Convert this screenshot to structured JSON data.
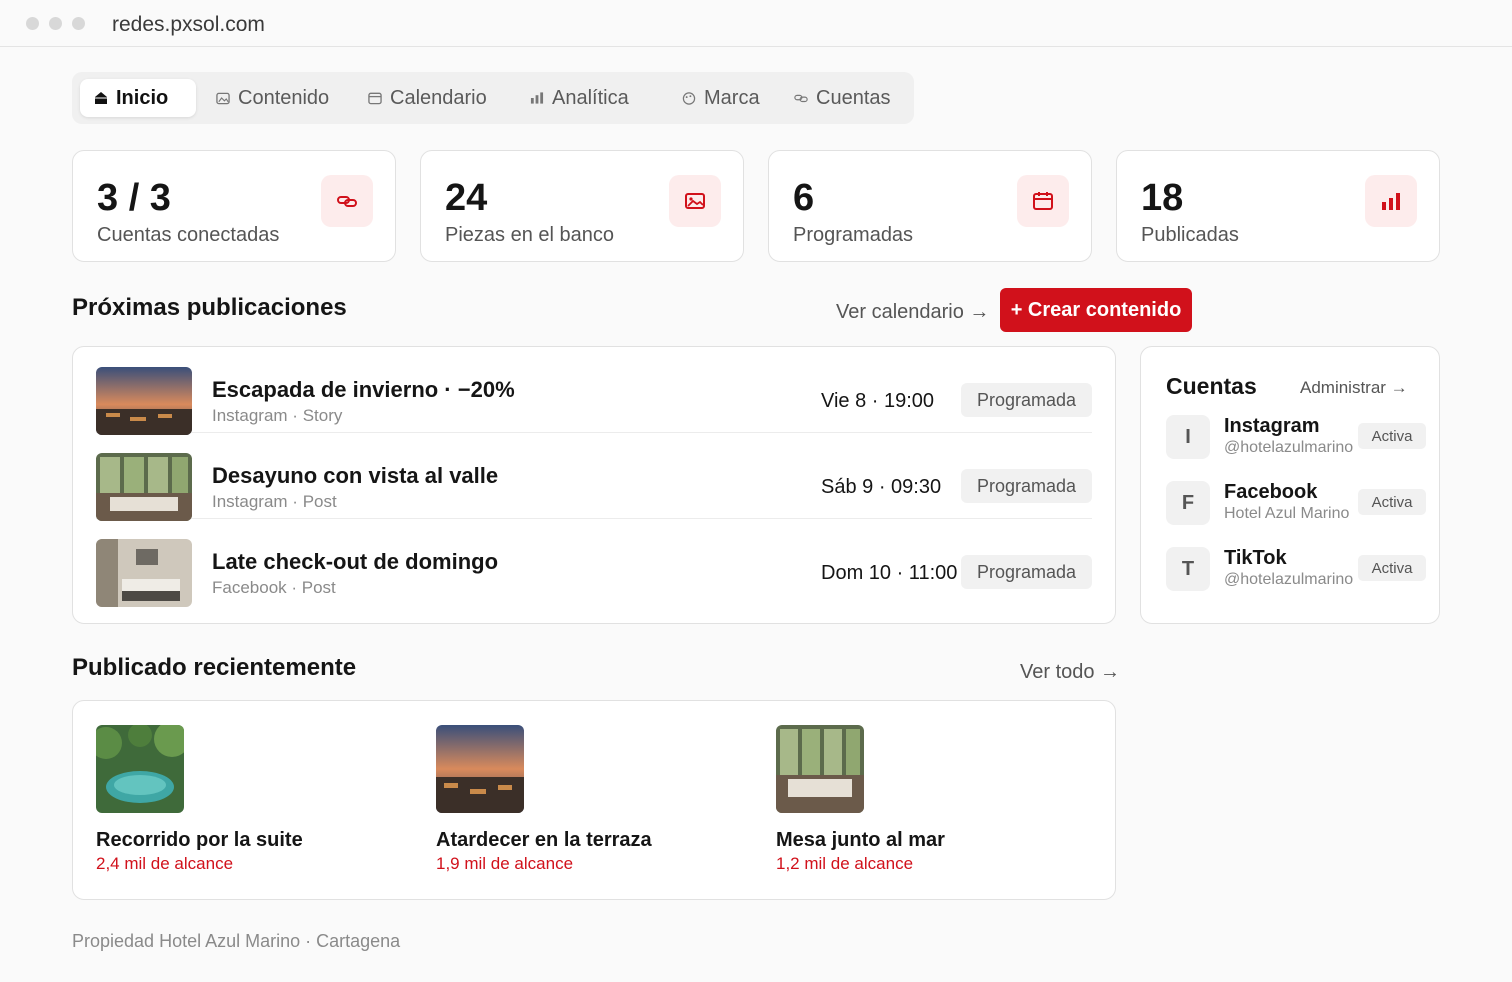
{
  "browser": {
    "url": "redes.pxsol.com"
  },
  "nav": {
    "tabs": [
      {
        "label": "Inicio",
        "icon": "home-icon",
        "active": true
      },
      {
        "label": "Contenido",
        "icon": "image-icon"
      },
      {
        "label": "Calendario",
        "icon": "calendar-icon"
      },
      {
        "label": "Analítica",
        "icon": "bar-chart-icon"
      },
      {
        "label": "Marca",
        "icon": "palette-icon"
      },
      {
        "label": "Cuentas",
        "icon": "link-icon"
      }
    ]
  },
  "stats": [
    {
      "value": "3 / 3",
      "label": "Cuentas conectadas",
      "icon": "link-icon"
    },
    {
      "value": "24",
      "label": "Piezas en el banco",
      "icon": "image-icon"
    },
    {
      "value": "6",
      "label": "Programadas",
      "icon": "calendar-icon"
    },
    {
      "value": "18",
      "label": "Publicadas",
      "icon": "bar-chart-icon"
    }
  ],
  "upcoming": {
    "title": "Próximas publicaciones",
    "calendar_link": "Ver calendario →",
    "create_button": "+ Crear contenido",
    "items": [
      {
        "title": "Escapada de invierno · −20%",
        "meta": "Instagram · Story",
        "date": "Vie 8 · 19:00",
        "status": "Programada",
        "thumb": "terrace-sunset"
      },
      {
        "title": "Desayuno con vista al valle",
        "meta": "Instagram · Post",
        "date": "Sáb 9 · 09:30",
        "status": "Programada",
        "thumb": "dining-room"
      },
      {
        "title": "Late check-out de domingo",
        "meta": "Facebook · Post",
        "date": "Dom 10 · 11:00",
        "status": "Programada",
        "thumb": "bedroom"
      }
    ]
  },
  "accounts": {
    "title": "Cuentas",
    "manage_link": "Administrar →",
    "items": [
      {
        "letter": "I",
        "name": "Instagram",
        "handle": "@hotelazulmarino",
        "status": "Activa"
      },
      {
        "letter": "F",
        "name": "Facebook",
        "handle": "Hotel Azul Marino",
        "status": "Activa"
      },
      {
        "letter": "T",
        "name": "TikTok",
        "handle": "@hotelazulmarino",
        "status": "Activa"
      }
    ]
  },
  "recent": {
    "title": "Publicado recientemente",
    "see_all": "Ver todo →",
    "items": [
      {
        "title": "Recorrido por la suite",
        "reach": "2,4 mil de alcance",
        "thumb": "pool-jungle"
      },
      {
        "title": "Atardecer en la terraza",
        "reach": "1,9 mil de alcance",
        "thumb": "terrace-sunset"
      },
      {
        "title": "Mesa junto al mar",
        "reach": "1,2 mil de alcance",
        "thumb": "dining-room"
      }
    ]
  },
  "footer": {
    "text": "Propiedad Hotel Azul Marino · Cartagena"
  },
  "colors": {
    "accent": "#d1111b",
    "accent_soft": "#fdecec",
    "background": "#fafafa"
  }
}
